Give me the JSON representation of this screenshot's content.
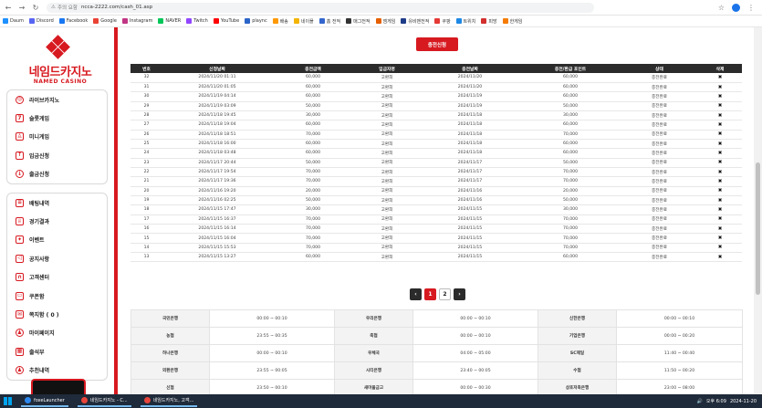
{
  "browser": {
    "not_secure": "주의 요함",
    "url": "ncca-2222.com/cash_01.asp",
    "bookmarks": [
      "Daum",
      "Discord",
      "Facebook",
      "Google",
      "Instagram",
      "NAVER",
      "Twitch",
      "YouTube",
      "plaync",
      "배송",
      "네이플",
      "홈 전적",
      "매그전적",
      "엠게임",
      "유비맨전적",
      "쿠팡",
      "트위치",
      "피망",
      "한게임"
    ],
    "bookmark_colors": [
      "#1e90ff",
      "#5865f2",
      "#1877f2",
      "#ea4335",
      "#c13584",
      "#03c75a",
      "#9146ff",
      "#ff0000",
      "#2b64c8",
      "#ff9900",
      "#f4b400",
      "#3366cc",
      "#333333",
      "#e66000",
      "#1f3c88",
      "#e53935",
      "#1e88e5",
      "#d32f2f",
      "#f57c00"
    ]
  },
  "logo": {
    "text": "네임드카지노",
    "sub": "NAMED CASINO"
  },
  "menu1": [
    {
      "label": "라이브카지노",
      "icon": "chip-icon"
    },
    {
      "label": "슬롯게임",
      "icon": "slot-icon"
    },
    {
      "label": "미니게임",
      "icon": "joystick-icon"
    },
    {
      "label": "입금신청",
      "icon": "deposit-icon"
    },
    {
      "label": "출금신청",
      "icon": "withdraw-icon"
    }
  ],
  "menu2": [
    {
      "label": "배팅내역",
      "icon": "list-icon"
    },
    {
      "label": "경기결과",
      "icon": "trophy-icon"
    },
    {
      "label": "이벤트",
      "icon": "gift-icon"
    },
    {
      "label": "공지사항",
      "icon": "megaphone-icon"
    },
    {
      "label": "고객센터",
      "icon": "headset-icon"
    },
    {
      "label": "쿠폰함",
      "icon": "coupon-icon"
    },
    {
      "label": "쪽지함 ( 0 )",
      "icon": "mail-icon"
    },
    {
      "label": "마이페이지",
      "icon": "user-icon"
    },
    {
      "label": "출석부",
      "icon": "calendar-icon"
    },
    {
      "label": "추천내역",
      "icon": "users-icon"
    }
  ],
  "recharge_label": "충전신청",
  "history": {
    "headers": [
      "번호",
      "신청날짜",
      "충전금액",
      "입금자명",
      "충전날짜",
      "충전/환급 포인트",
      "상태",
      "삭제"
    ],
    "rows": [
      [
        "32",
        "2024/11/20 01:11",
        "60,000",
        "고환희",
        "2024/11/20",
        "60,000",
        "충전완료",
        "✖"
      ],
      [
        "31",
        "2024/11/20 01:05",
        "60,000",
        "고환희",
        "2024/11/20",
        "60,000",
        "충전완료",
        "✖"
      ],
      [
        "30",
        "2024/11/19 04:14",
        "60,000",
        "고환희",
        "2024/11/19",
        "60,000",
        "충전완료",
        "✖"
      ],
      [
        "29",
        "2024/11/19 03:09",
        "50,000",
        "고환희",
        "2024/11/19",
        "50,000",
        "충전완료",
        "✖"
      ],
      [
        "28",
        "2024/11/18 19:45",
        "30,000",
        "고환희",
        "2024/11/18",
        "30,000",
        "충전완료",
        "✖"
      ],
      [
        "27",
        "2024/11/18 19:04",
        "60,000",
        "고환희",
        "2024/11/18",
        "60,000",
        "충전완료",
        "✖"
      ],
      [
        "26",
        "2024/11/18 18:51",
        "70,000",
        "고환희",
        "2024/11/18",
        "70,000",
        "충전완료",
        "✖"
      ],
      [
        "25",
        "2024/11/18 16:00",
        "60,000",
        "고환희",
        "2024/11/18",
        "60,000",
        "충전완료",
        "✖"
      ],
      [
        "24",
        "2024/11/18 03:48",
        "60,000",
        "고환희",
        "2024/11/18",
        "60,000",
        "충전완료",
        "✖"
      ],
      [
        "23",
        "2024/11/17 20:44",
        "50,000",
        "고환희",
        "2024/11/17",
        "50,000",
        "충전완료",
        "✖"
      ],
      [
        "22",
        "2024/11/17 19:54",
        "70,000",
        "고환희",
        "2024/11/17",
        "70,000",
        "충전완료",
        "✖"
      ],
      [
        "21",
        "2024/11/17 19:36",
        "70,000",
        "고환희",
        "2024/11/17",
        "70,000",
        "충전완료",
        "✖"
      ],
      [
        "20",
        "2024/11/16 19:20",
        "20,000",
        "고환희",
        "2024/11/16",
        "20,000",
        "충전완료",
        "✖"
      ],
      [
        "19",
        "2024/11/16 02:25",
        "50,000",
        "고환희",
        "2024/11/16",
        "50,000",
        "충전완료",
        "✖"
      ],
      [
        "18",
        "2024/11/15 17:47",
        "30,000",
        "고환희",
        "2024/11/15",
        "30,000",
        "충전완료",
        "✖"
      ],
      [
        "17",
        "2024/11/15 16:37",
        "70,000",
        "고환희",
        "2024/11/15",
        "70,000",
        "충전완료",
        "✖"
      ],
      [
        "16",
        "2024/11/15 16:14",
        "70,000",
        "고환희",
        "2024/11/15",
        "70,000",
        "충전완료",
        "✖"
      ],
      [
        "15",
        "2024/11/15 16:04",
        "70,000",
        "고환희",
        "2024/11/15",
        "70,000",
        "충전완료",
        "✖"
      ],
      [
        "14",
        "2024/11/15 15:53",
        "70,000",
        "고환희",
        "2024/11/15",
        "70,000",
        "충전완료",
        "✖"
      ],
      [
        "13",
        "2024/11/15 13:27",
        "60,000",
        "고환희",
        "2024/11/15",
        "60,000",
        "충전완료",
        "✖"
      ]
    ]
  },
  "pager": {
    "prev": "‹",
    "pages": [
      "1",
      "2"
    ],
    "next": "›",
    "active": "1"
  },
  "banks": [
    [
      "국민은행",
      "00:00 ~ 00:10",
      "우리은행",
      "00:00 ~ 00:10",
      "신한은행",
      "00:00 ~ 00:10"
    ],
    [
      "농협",
      "23:55 ~ 00:35",
      "축협",
      "00:00 ~ 00:10",
      "기업은행",
      "00:00 ~ 00:20"
    ],
    [
      "하나은행",
      "00:00 ~ 00:10",
      "우체국",
      "04:00 ~ 05:00",
      "SC제일",
      "11:40 ~ 00:40"
    ],
    [
      "외환은행",
      "23:55 ~ 00:05",
      "시티은행",
      "23:40 ~ 00:05",
      "수협",
      "11:50 ~ 00:20"
    ],
    [
      "신협",
      "23:50 ~ 00:10",
      "새마을금고",
      "00:00 ~ 00:30",
      "상호저축은행",
      "23:00 ~ 08:00"
    ],
    [
      "경기은행",
      "23:40 ~ 00:50",
      "경남은행",
      "23:50 ~ 00:00",
      "광주은행",
      "23:00 ~ 00:00"
    ]
  ],
  "taskbar": {
    "tasks": [
      "foxeLauncher",
      "네임드카지노 - C...",
      "네임드카지노, 고객..."
    ],
    "time": "오후 6:09",
    "date": "2024-11-20"
  }
}
